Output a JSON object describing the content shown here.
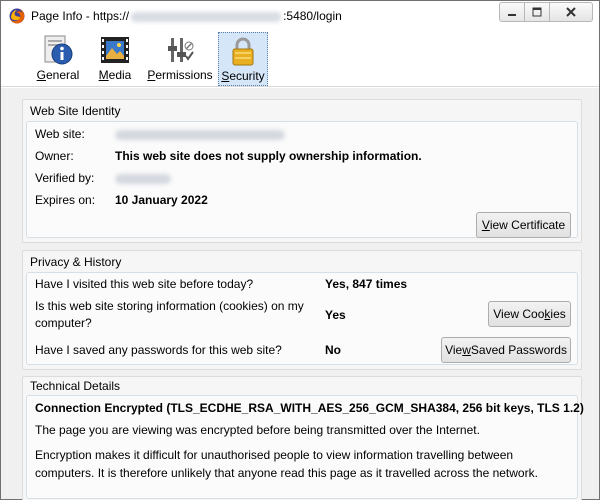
{
  "window": {
    "title_prefix": "Page Info - https://",
    "title_suffix": ":5480/login"
  },
  "tabs": [
    {
      "label": "General",
      "accel": "G",
      "rest": "eneral",
      "icon": "info-icon",
      "selected": false
    },
    {
      "label": "Media",
      "accel": "M",
      "rest": "edia",
      "icon": "media-icon",
      "selected": false
    },
    {
      "label": "Permissions",
      "accel": "P",
      "rest": "ermissions",
      "icon": "permissions-icon",
      "selected": false
    },
    {
      "label": "Security",
      "accel": "S",
      "rest": "ecurity",
      "icon": "padlock-icon",
      "selected": true
    }
  ],
  "identity": {
    "title": "Web Site Identity",
    "website_label": "Web site:",
    "owner_label": "Owner:",
    "owner_value": "This web site does not supply ownership information.",
    "verified_label": "Verified by:",
    "expires_label": "Expires on:",
    "expires_value": "10 January 2022",
    "view_certificate_pre": "",
    "view_certificate_accel": "V",
    "view_certificate_post": "iew Certificate"
  },
  "privacy": {
    "title": "Privacy & History",
    "visited_q": "Have I visited this web site before today?",
    "visited_a": "Yes, 847 times",
    "cookies_q_line1": "Is this web site storing information (cookies) on my",
    "cookies_q_line2": "computer?",
    "cookies_a": "Yes",
    "view_cookies_pre": "View Coo",
    "view_cookies_accel": "k",
    "view_cookies_post": "ies",
    "passwords_q": "Have I saved any passwords for this web site?",
    "passwords_a": "No",
    "view_passwords_pre": "Vie",
    "view_passwords_accel": "w",
    "view_passwords_post": " Saved Passwords"
  },
  "technical": {
    "title": "Technical Details",
    "connection": "Connection Encrypted (TLS_ECDHE_RSA_WITH_AES_256_GCM_SHA384, 256 bit keys, TLS 1.2)",
    "line1": "The page you are viewing was encrypted before being transmitted over the Internet.",
    "line2": "Encryption makes it difficult for unauthorised people to view information travelling between",
    "line3": "computers. It is therefore unlikely that anyone read this page as it travelled across the network."
  },
  "colors": {
    "selected_tab_bg": "#d5e6f8",
    "firefox_orange": "#e66000"
  }
}
